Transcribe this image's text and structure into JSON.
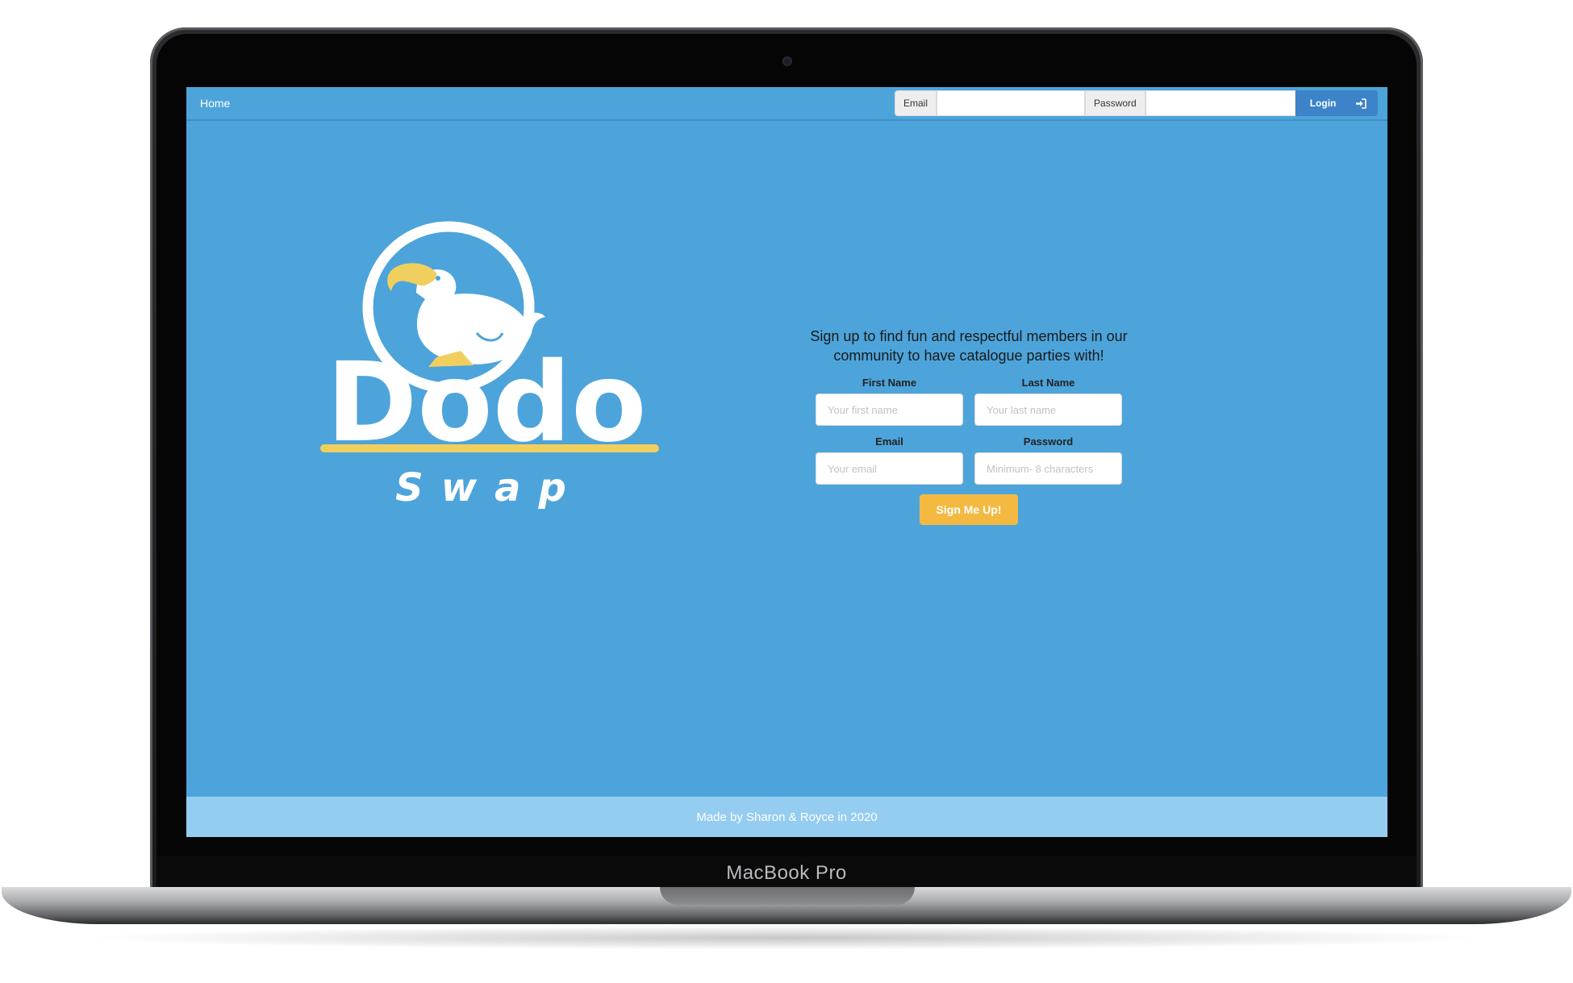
{
  "device": {
    "model_label": "MacBook Pro"
  },
  "navbar": {
    "home_label": "Home",
    "email_addon": "Email",
    "password_addon": "Password",
    "login_label": "Login",
    "login_icon": "sign-in-icon"
  },
  "logo": {
    "wordmark": "Dodo",
    "subtitle": "Swap",
    "mascot_icon": "dodo-bird-icon"
  },
  "signup": {
    "tagline_line1": "Sign up to find fun and respectful members in our",
    "tagline_line2": "community to have catalogue parties with!",
    "first_name_label": "First Name",
    "first_name_placeholder": "Your first name",
    "last_name_label": "Last Name",
    "last_name_placeholder": "Your last name",
    "email_label": "Email",
    "email_placeholder": "Your email",
    "password_label": "Password",
    "password_placeholder": "Minimum- 8 characters",
    "submit_label": "Sign Me Up!"
  },
  "footer": {
    "text": "Made by Sharon & Royce in 2020"
  },
  "colors": {
    "background": "#4da4db",
    "footer": "#95cdf1",
    "accent_yellow": "#f4b941",
    "login_button": "#3c83c9"
  }
}
